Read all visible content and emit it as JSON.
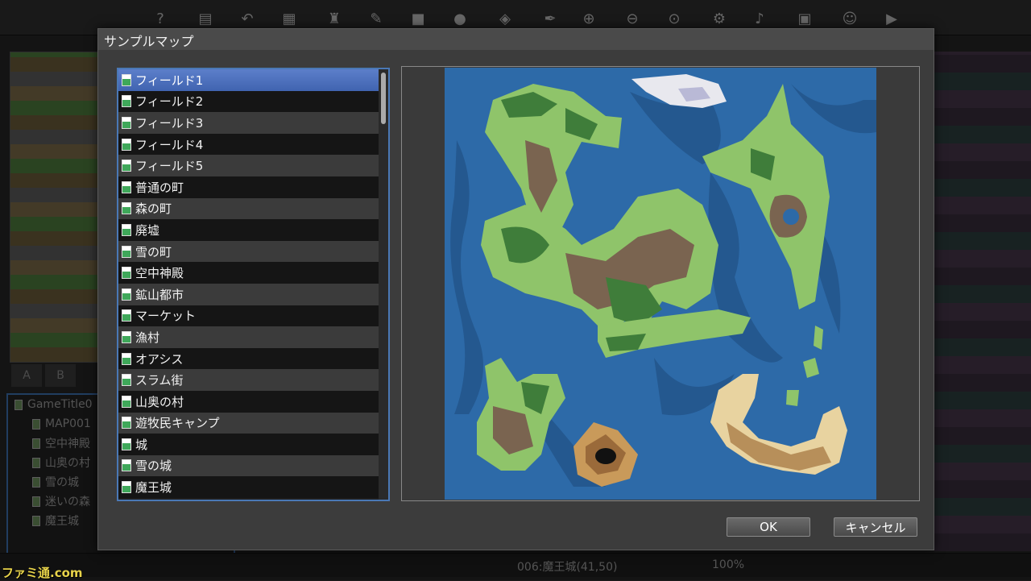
{
  "dialog": {
    "title": "サンプルマップ",
    "maps": [
      {
        "label": "フィールド1",
        "selected": true
      },
      {
        "label": "フィールド2"
      },
      {
        "label": "フィールド3"
      },
      {
        "label": "フィールド4"
      },
      {
        "label": "フィールド5"
      },
      {
        "label": "普通の町"
      },
      {
        "label": "森の町"
      },
      {
        "label": "廃墟"
      },
      {
        "label": "雪の町"
      },
      {
        "label": "空中神殿"
      },
      {
        "label": "鉱山都市"
      },
      {
        "label": "マーケット"
      },
      {
        "label": "漁村"
      },
      {
        "label": "オアシス"
      },
      {
        "label": "スラム街"
      },
      {
        "label": "山奥の村"
      },
      {
        "label": "遊牧民キャンプ"
      },
      {
        "label": "城"
      },
      {
        "label": "雪の城"
      },
      {
        "label": "魔王城"
      }
    ],
    "ok_label": "OK",
    "cancel_label": "キャンセル"
  },
  "editor": {
    "tile_tabs": [
      "A",
      "B"
    ],
    "map_tree": {
      "root": "GameTitle0",
      "items": [
        "MAP001",
        "空中神殿",
        "山奥の村",
        "雪の城",
        "迷いの森",
        "魔王城"
      ]
    },
    "status": {
      "map": "006:魔王城(41,50)",
      "zoom": "100%"
    }
  },
  "watermark": "ファミ通.com",
  "colors": {
    "ocean": "#2d6aa8",
    "grass": "#8fc46a",
    "forest": "#3f7d3a",
    "mountain": "#7a6450",
    "sand": "#e8d3a0",
    "snow": "#e8e8ee",
    "selection": "#4a6fbf"
  }
}
